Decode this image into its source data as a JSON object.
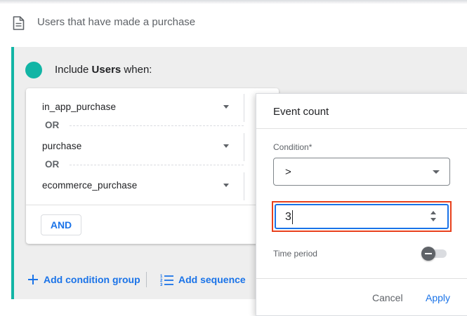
{
  "header": {
    "title": "Users that have made a purchase",
    "icon": "document-icon"
  },
  "group": {
    "accent_color": "#12b5a5",
    "include_prefix": "Include",
    "include_entity": "Users",
    "include_suffix": "when:",
    "events": [
      {
        "label": "in_app_purchase"
      },
      {
        "label": "purchase"
      },
      {
        "label": "ecommerce_purchase"
      }
    ],
    "or_label": "OR",
    "and_label": "AND",
    "add_condition_group_label": "Add condition group",
    "add_sequence_label": "Add sequence"
  },
  "popover": {
    "title": "Event count",
    "condition_label": "Condition*",
    "condition_value": ">",
    "count_value": "3",
    "time_period_label": "Time period",
    "time_period_enabled": false,
    "cancel_label": "Cancel",
    "apply_label": "Apply"
  },
  "colors": {
    "accent_blue": "#1a73e8",
    "highlight_red": "#e8401c"
  }
}
